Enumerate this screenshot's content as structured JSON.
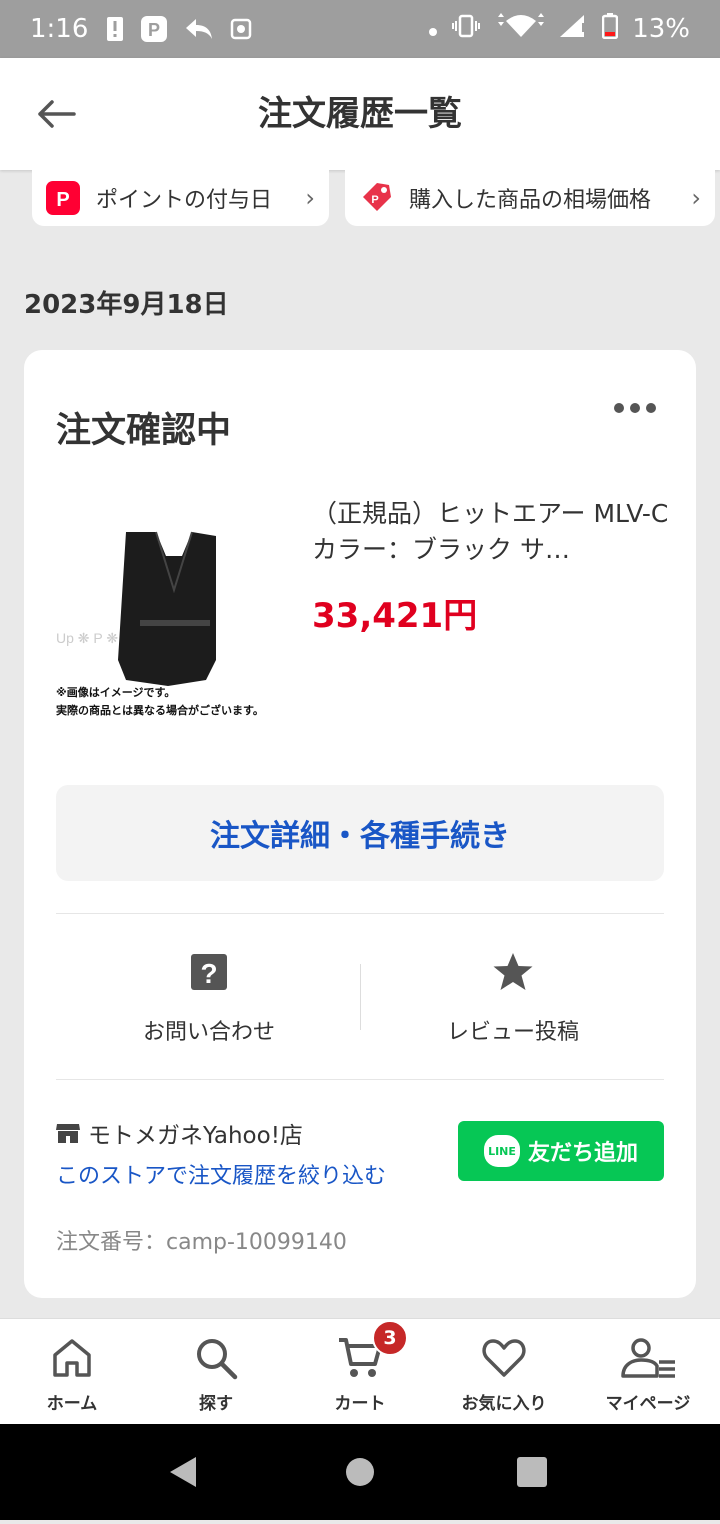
{
  "status_bar": {
    "time": "1:16",
    "battery": "13%",
    "icons": [
      "alert-icon",
      "paypay-icon",
      "reply-icon",
      "settings-icon",
      "dot-icon",
      "vibrate-icon",
      "wifi-icon",
      "signal-icon",
      "battery-icon"
    ]
  },
  "header": {
    "title": "注文履歴一覧"
  },
  "chips": [
    {
      "label": "ポイントの付与日",
      "icon": "paypay-point-icon"
    },
    {
      "label": "購入した商品の相場価格",
      "icon": "price-tag-icon"
    }
  ],
  "date": "2023年9月18日",
  "order": {
    "status": "注文確認中",
    "product_name": "（正規品）ヒットエアー MLV-C カラー：ブラック サ…",
    "price": "33,421円",
    "image_caption_1": "※画像はイメージです。",
    "image_caption_2": "実際の商品とは異なる場合がございます。",
    "detail_button": "注文詳細・各種手続き",
    "inquiry_label": "お問い合わせ",
    "review_label": "レビュー投稿",
    "store_name": "モトメガネYahoo!店",
    "filter_link": "このストアで注文履歴を絞り込む",
    "line_button": "友だち追加",
    "line_logo": "LINE",
    "order_number": "注文番号：camp-10099140"
  },
  "tabbar": {
    "items": [
      {
        "label": "ホーム",
        "icon": "home-icon"
      },
      {
        "label": "探す",
        "icon": "search-icon"
      },
      {
        "label": "カート",
        "icon": "cart-icon"
      },
      {
        "label": "お気に入り",
        "icon": "heart-icon"
      },
      {
        "label": "マイページ",
        "icon": "mypage-icon"
      }
    ],
    "cart_badge": "3"
  },
  "colors": {
    "price": "#e0001f",
    "link": "#1956c6",
    "line_green": "#06c755",
    "badge": "#c62828",
    "paypay_red": "#ff0033"
  }
}
